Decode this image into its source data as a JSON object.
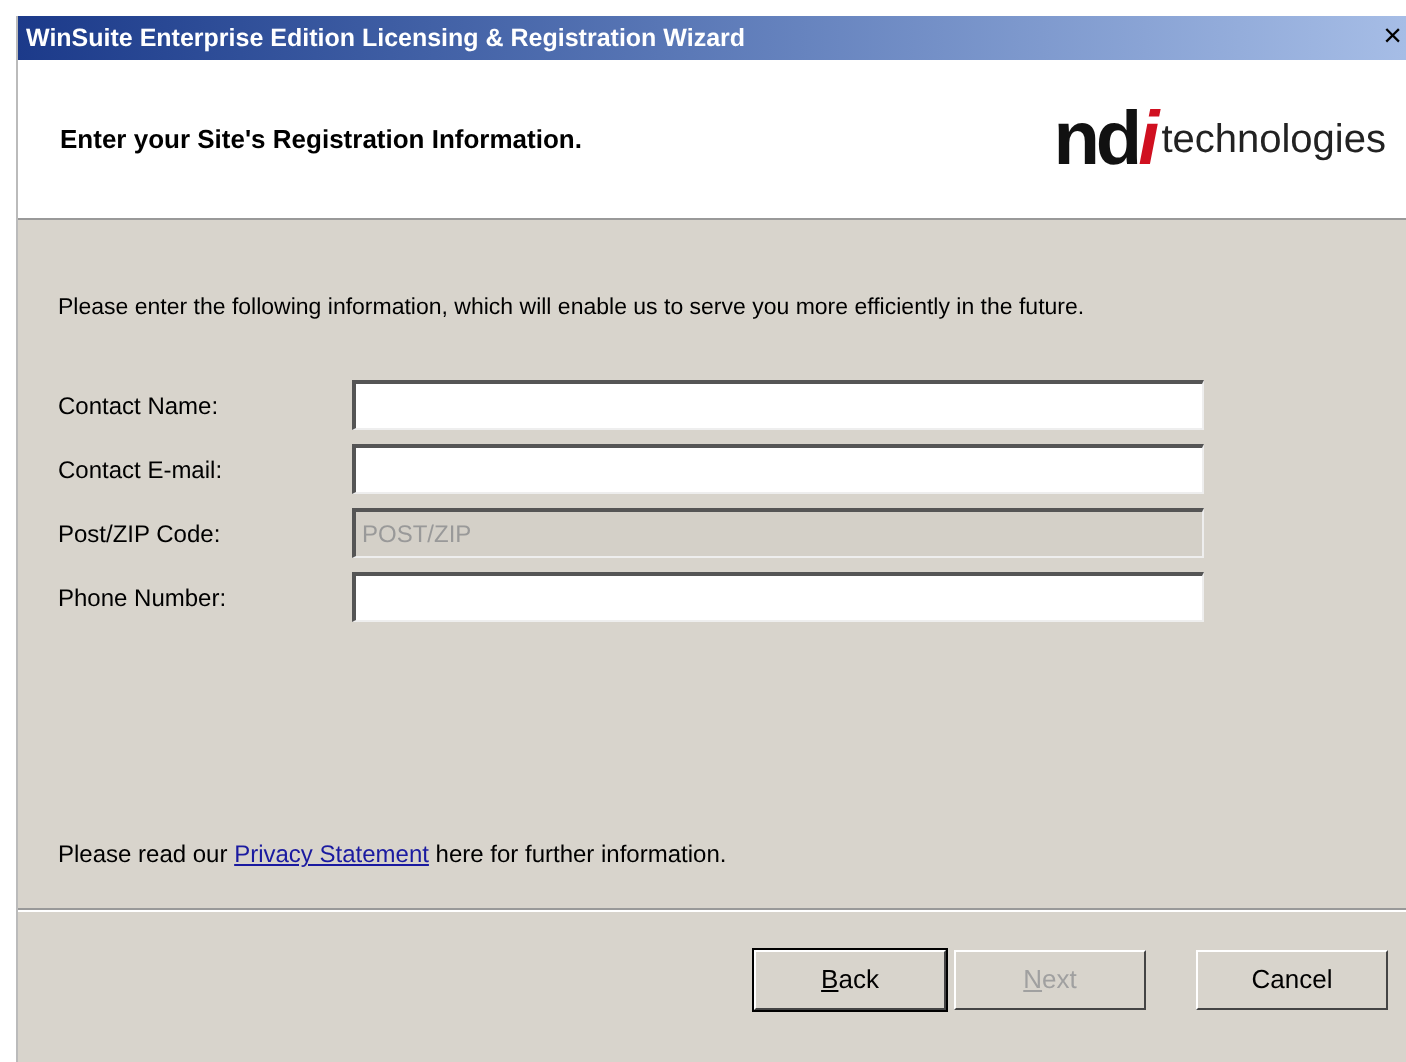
{
  "window": {
    "title": "WinSuite Enterprise Edition Licensing & Registration Wizard",
    "close": "×"
  },
  "header": {
    "heading": "Enter your Site's Registration Information.",
    "logo": {
      "mark": "nd",
      "accent": "i",
      "word": "technologies"
    }
  },
  "intro": "Please enter the following information, which will enable us to serve you more efficiently in the future.",
  "fields": [
    {
      "label": "Contact Name:",
      "disabled": false
    },
    {
      "label": "Contact E-mail:",
      "disabled": false
    },
    {
      "label": "Post/ZIP Code:",
      "value": "POST/ZIP",
      "disabled": true
    },
    {
      "label": "Phone Number:",
      "disabled": false
    }
  ],
  "privacy": {
    "before": "Please read our",
    "link": "Privacy Statement",
    "after": "here for further information."
  },
  "buttons": [
    {
      "access_key": "B",
      "label_rest": "ack",
      "disabled": false
    },
    {
      "access_key": "N",
      "label_rest": "ext",
      "disabled": true
    },
    {
      "label_rest": "Cancel",
      "disabled": false
    }
  ]
}
